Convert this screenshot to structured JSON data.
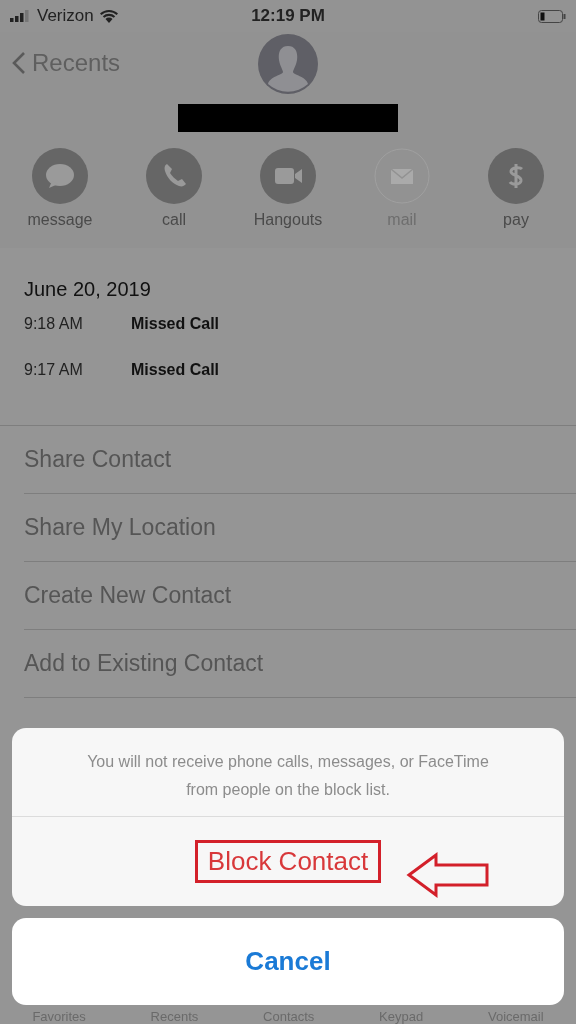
{
  "status_bar": {
    "carrier": "Verizon",
    "time": "12:19 PM"
  },
  "nav": {
    "back_label": "Recents"
  },
  "actions": [
    {
      "label": "message",
      "kind": "message",
      "disabled": false
    },
    {
      "label": "call",
      "kind": "call",
      "disabled": false
    },
    {
      "label": "Hangouts",
      "kind": "video",
      "disabled": false
    },
    {
      "label": "mail",
      "kind": "mail",
      "disabled": true
    },
    {
      "label": "pay",
      "kind": "pay",
      "disabled": false
    }
  ],
  "history": {
    "date": "June 20, 2019",
    "entries": [
      {
        "time": "9:18 AM",
        "type": "Missed Call"
      },
      {
        "time": "9:17 AM",
        "type": "Missed Call"
      }
    ]
  },
  "options": [
    "Share Contact",
    "Share My Location",
    "Create New Contact",
    "Add to Existing Contact"
  ],
  "action_sheet": {
    "message": "You will not receive phone calls, messages, or FaceTime from people on the block list.",
    "destructive": {
      "label": "Block Contact",
      "highlighted": true
    },
    "cancel": "Cancel"
  },
  "tab_bar": [
    "Favorites",
    "Recents",
    "Contacts",
    "Keypad",
    "Voicemail"
  ]
}
